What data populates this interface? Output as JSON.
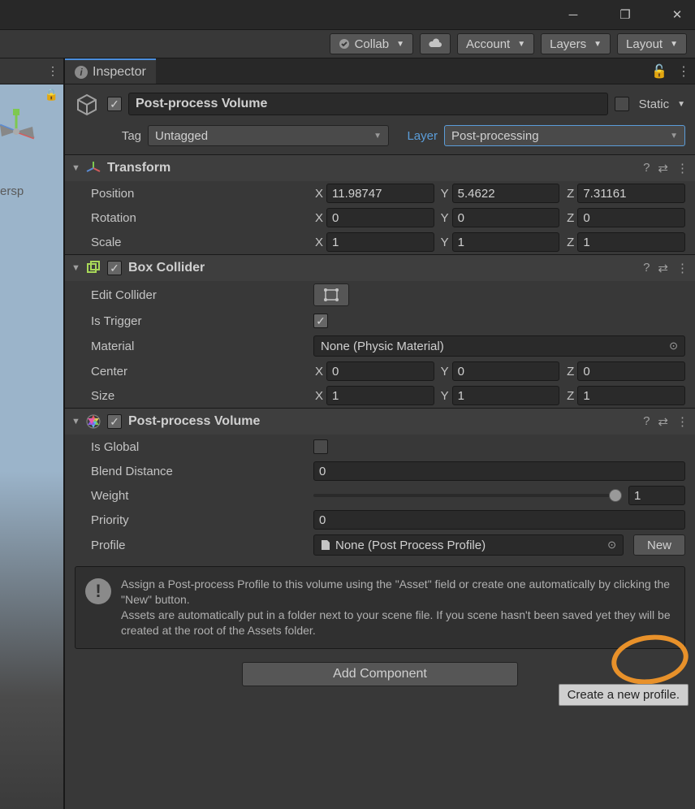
{
  "titlebar": {
    "minimize": "─",
    "maximize": "❐",
    "close": "✕"
  },
  "toolbar": {
    "collab": "Collab",
    "account": "Account",
    "layers": "Layers",
    "layout": "Layout"
  },
  "scene": {
    "persp": "ersp"
  },
  "inspector": {
    "tab": "Inspector",
    "object_name": "Post-process Volume",
    "static_label": "Static",
    "tag_label": "Tag",
    "tag_value": "Untagged",
    "layer_label": "Layer",
    "layer_value": "Post-processing"
  },
  "transform": {
    "title": "Transform",
    "position_label": "Position",
    "rotation_label": "Rotation",
    "scale_label": "Scale",
    "x": "X",
    "y": "Y",
    "z": "Z",
    "pos": {
      "x": "11.98747",
      "y": "5.4622",
      "z": "7.31161"
    },
    "rot": {
      "x": "0",
      "y": "0",
      "z": "0"
    },
    "scl": {
      "x": "1",
      "y": "1",
      "z": "1"
    }
  },
  "boxcollider": {
    "title": "Box Collider",
    "edit_collider": "Edit Collider",
    "is_trigger": "Is Trigger",
    "material": "Material",
    "material_value": "None (Physic Material)",
    "center": "Center",
    "size": "Size",
    "ctr": {
      "x": "0",
      "y": "0",
      "z": "0"
    },
    "siz": {
      "x": "1",
      "y": "1",
      "z": "1"
    }
  },
  "ppv": {
    "title": "Post-process Volume",
    "is_global": "Is Global",
    "blend_distance": "Blend Distance",
    "blend_distance_value": "0",
    "weight": "Weight",
    "weight_value": "1",
    "priority": "Priority",
    "priority_value": "0",
    "profile": "Profile",
    "profile_value": "None (Post Process Profile)",
    "new_button": "New",
    "help": "Assign a Post-process Profile to this volume using the \"Asset\" field or create one automatically by clicking the \"New\" button.\nAssets are automatically put in a folder next to your scene file. If you scene hasn't been saved yet they will be created at the root of the Assets folder."
  },
  "tooltip": "Create a new profile.",
  "add_component": "Add Component",
  "axis": {
    "x": "X",
    "y": "Y",
    "z": "Z"
  }
}
